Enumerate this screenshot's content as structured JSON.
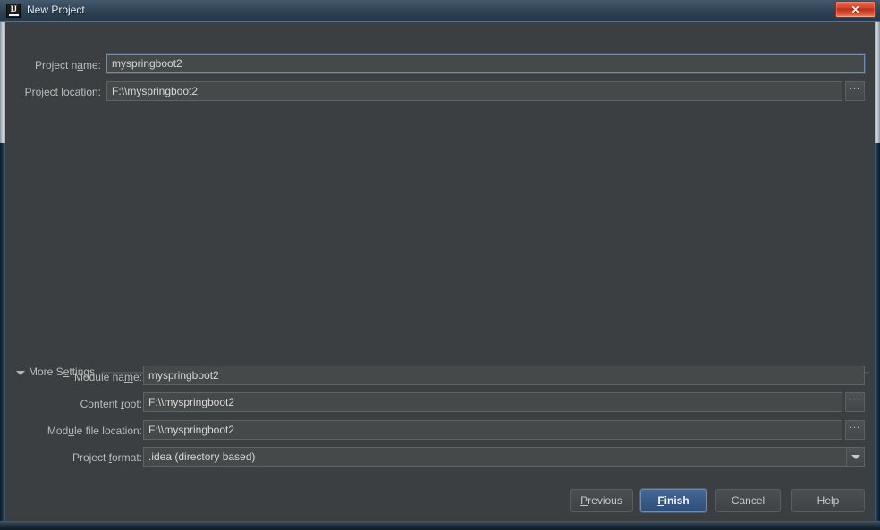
{
  "window": {
    "title": "New Project",
    "icon": "intellij-idea-icon",
    "close_label": "✕",
    "accent_color": "#3a5a87",
    "background_color": "#3c3f41",
    "titlebar_color": "#34495c",
    "close_button_color": "#d4442a"
  },
  "form": {
    "project_name": {
      "label_before": "Project n",
      "label_mnemonic": "a",
      "label_after": "me:",
      "value": "myspringboot2"
    },
    "project_location": {
      "label_before": "Project ",
      "label_mnemonic": "l",
      "label_after": "ocation:",
      "value": "F:\\\\myspringboot2",
      "browse_label": "..."
    }
  },
  "more_settings": {
    "label_before": "More S",
    "label_mnemonic": "e",
    "label_after": "ttings",
    "expanded": true,
    "collapse_icon": "triangle-down-icon",
    "fields": {
      "module_name": {
        "label_before": "Module na",
        "label_mnemonic": "m",
        "label_after": "e:",
        "value": "myspringboot2"
      },
      "content_root": {
        "label_before": "Content ",
        "label_mnemonic": "r",
        "label_after": "oot:",
        "value": "F:\\\\myspringboot2",
        "browse_label": "..."
      },
      "module_file_location": {
        "label_before": "Mod",
        "label_mnemonic": "u",
        "label_after": "le file location:",
        "value": "F:\\\\myspringboot2",
        "browse_label": "..."
      },
      "project_format": {
        "label_before": "Project ",
        "label_mnemonic": "f",
        "label_after": "ormat:",
        "value": ".idea (directory based)",
        "dropdown_icon": "chevron-down-icon"
      }
    }
  },
  "buttons": {
    "previous": {
      "before": "",
      "mnemonic": "P",
      "after": "revious"
    },
    "finish": {
      "before": "",
      "mnemonic": "F",
      "after": "inish"
    },
    "cancel": {
      "before": "Cancel",
      "mnemonic": "",
      "after": ""
    },
    "help": {
      "before": "Help",
      "mnemonic": "",
      "after": ""
    }
  }
}
